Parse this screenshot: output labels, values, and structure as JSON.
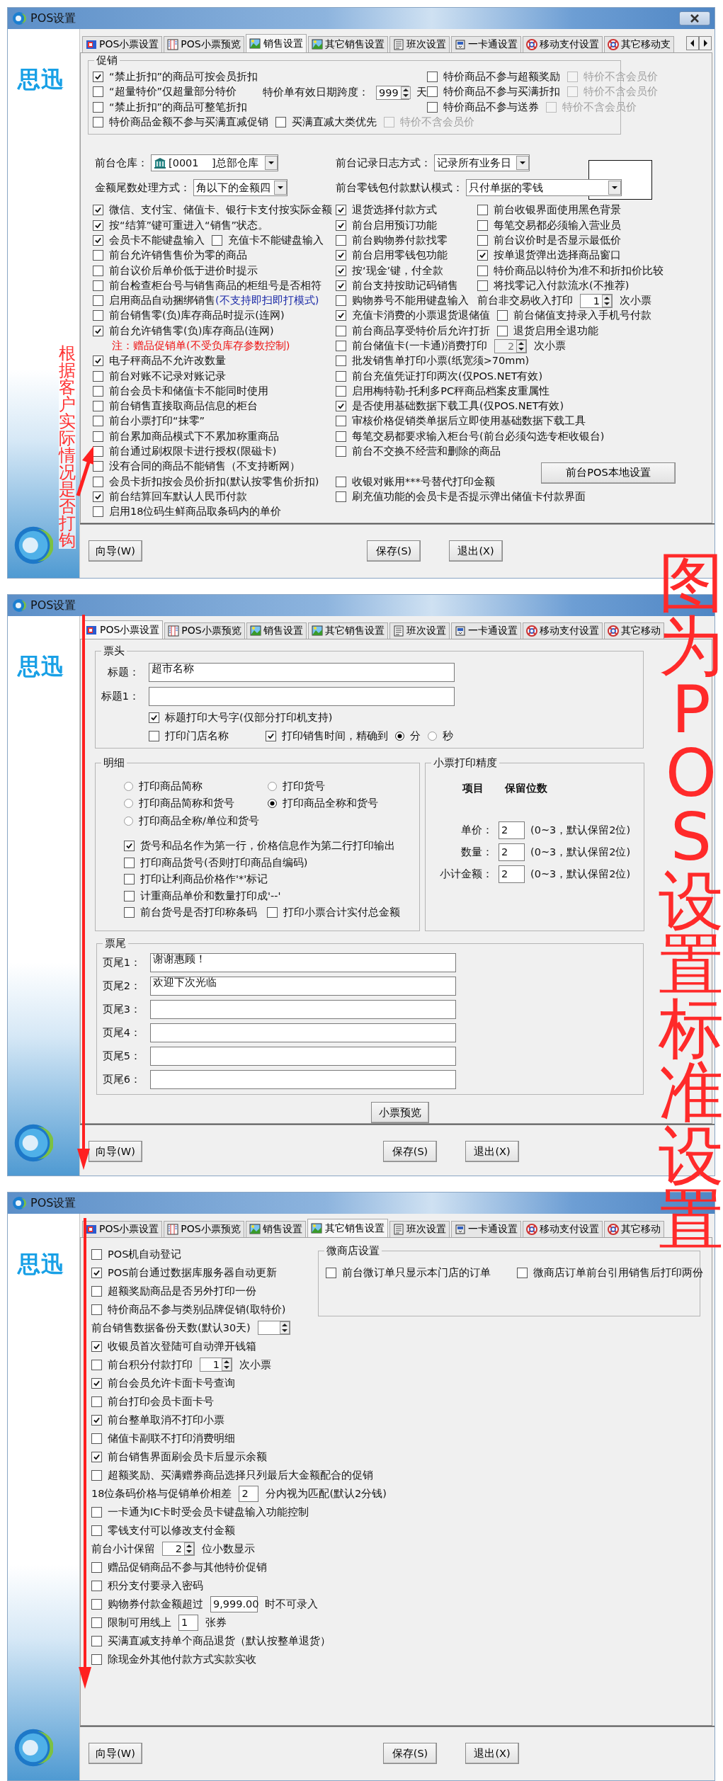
{
  "windows": [
    {
      "title": "POS设置",
      "brand": "思迅",
      "kind": "sales",
      "close_button": true,
      "tab_arrows": true,
      "tabs": [
        {
          "label": "POS小票设置",
          "selected": false
        },
        {
          "label": "POS小票预览",
          "selected": false
        },
        {
          "label": "销售设置",
          "selected": true
        },
        {
          "label": "其它销售设置",
          "selected": false
        },
        {
          "label": "班次设置",
          "selected": false
        },
        {
          "label": "一卡通设置",
          "selected": false
        },
        {
          "label": "移动支付设置",
          "selected": false
        },
        {
          "label": "其它移动支",
          "selected": false
        }
      ],
      "promo": {
        "title": "促销",
        "left": [
          [
            {
              "kind": "check",
              "label": "“禁止折扣”的商品可按会员折扣",
              "checked": true
            }
          ],
          [
            {
              "kind": "check",
              "label": "“超量特价”仅超量部分特价",
              "checked": false
            }
          ],
          [
            {
              "kind": "check",
              "label": "“禁止折扣”的商品可整笔折扣",
              "checked": false
            }
          ],
          [
            {
              "kind": "check",
              "label": "特价商品金额不参与买满直减促销",
              "checked": false
            },
            {
              "kind": "check",
              "label": "买满直减大类优先",
              "checked": false
            },
            {
              "kind": "disabled_check",
              "label": "特价不含会员价",
              "checked": false
            }
          ]
        ],
        "validity": [
          {
            "kind": "text",
            "text": "特价单有效日期跨度："
          },
          {
            "kind": "spin",
            "value": "999"
          },
          {
            "kind": "text",
            "text": "天"
          }
        ],
        "right": [
          [
            {
              "kind": "check",
              "label": "特价商品不参与超额奖励",
              "checked": false
            },
            {
              "kind": "disabled_check",
              "label": "特价不含会员价",
              "checked": false
            }
          ],
          [
            {
              "kind": "check",
              "label": "特价商品不参与买满折扣",
              "checked": false
            },
            {
              "kind": "disabled_check",
              "label": "特价不含会员价",
              "checked": false
            }
          ],
          [
            {
              "kind": "check",
              "label": "特价商品不参与送券",
              "checked": false
            },
            {
              "kind": "disabled_check",
              "label": "特价不含会员价",
              "checked": false
            }
          ]
        ]
      },
      "selects": [
        {
          "kind": "warehouse_combo",
          "label": "前台仓库：",
          "value": "[0001    ]总部仓库"
        },
        {
          "kind": "combo",
          "label": "前台记录日志方式：",
          "value": "记录所有业务日"
        },
        {
          "kind": "combo",
          "label": "金额尾数处理方式：",
          "value": "角以下的金额四"
        },
        {
          "kind": "combo",
          "label": "前台零钱包付款默认模式：",
          "value": "只付单据的零钱"
        }
      ],
      "left": [
        [
          {
            "kind": "check",
            "label": "微信、支付宝、储值卡、银行卡支付按实际金额",
            "checked": true
          }
        ],
        [
          {
            "kind": "check",
            "label": "按“结算”键可重进入“销售”状态。",
            "checked": true
          }
        ],
        [
          {
            "kind": "check",
            "label": "会员卡不能键盘输入",
            "checked": true
          },
          {
            "kind": "check",
            "label": "充值卡不能键盘输入",
            "checked": false
          }
        ],
        [
          {
            "kind": "check",
            "label": "前台允许销售售价为零的商品",
            "checked": false
          }
        ],
        [
          {
            "kind": "check",
            "label": "前台议价后单价低于进价时提示",
            "checked": false
          }
        ],
        [
          {
            "kind": "check",
            "label": "前台检查柜台号与销售商品的柜组号是否相符",
            "checked": false
          }
        ],
        [
          {
            "kind": "check",
            "label": "启用商品自动捆绑销售",
            "hint": "(不支持即扫即打模式)",
            "checked": false
          }
        ],
        [
          {
            "kind": "check",
            "label": "前台销售零(负)库存商品时提示(连网)",
            "checked": false
          }
        ],
        [
          {
            "kind": "check",
            "label": "前台允许销售零(负)库存商品(连网)",
            "checked": true
          }
        ],
        [
          {
            "kind": "note",
            "text": "注：赠品促销单(不受负库存参数控制)"
          }
        ],
        [
          {
            "kind": "check",
            "label": "电子秤商品不允许改数量",
            "checked": true
          }
        ],
        [
          {
            "kind": "check",
            "label": "前台对账不记录对账记录",
            "checked": false
          }
        ],
        [
          {
            "kind": "check",
            "label": "前台会员卡和储值卡不能同时使用",
            "checked": false
          }
        ],
        [
          {
            "kind": "check",
            "label": "前台销售直接取商品信息的柜台",
            "checked": false
          }
        ],
        [
          {
            "kind": "check",
            "label": "前台小票打印“抹零”",
            "checked": false
          }
        ],
        [
          {
            "kind": "check",
            "label": "前台累加商品模式下不累加称重商品",
            "checked": false
          }
        ],
        [
          {
            "kind": "check",
            "label": "前台通过刷权限卡进行授权(限磁卡)",
            "checked": false
          }
        ],
        [
          {
            "kind": "check",
            "label": "没有合同的商品不能销售（不支持断网）",
            "checked": false
          }
        ],
        [
          {
            "kind": "check",
            "label": "会员卡折扣按会员价折扣(默认按零售价折扣)",
            "checked": false
          }
        ],
        [
          {
            "kind": "check",
            "label": "前台结算回车默认人民币付款",
            "checked": true
          }
        ],
        [
          {
            "kind": "check",
            "label": "启用18位码生鲜商品取条码内的单价",
            "checked": false
          }
        ]
      ],
      "right": [
        [
          {
            "kind": "check",
            "label": "退货选择付款方式",
            "checked": true
          },
          {
            "kind": "check",
            "label": "前台收银界面使用黑色背景",
            "checked": false
          }
        ],
        [
          {
            "kind": "check",
            "label": "前台启用预订功能",
            "checked": true
          },
          {
            "kind": "check",
            "label": "每笔交易都必须输入营业员",
            "checked": false
          }
        ],
        [
          {
            "kind": "check",
            "label": "前台购物券付款找零",
            "checked": false
          },
          {
            "kind": "check",
            "label": "前台议价时是否显示最低价",
            "checked": false
          }
        ],
        [
          {
            "kind": "check",
            "label": "前台启用零钱包功能",
            "checked": true
          },
          {
            "kind": "check",
            "label": "按单退货弹出选择商品窗口",
            "checked": true
          }
        ],
        [
          {
            "kind": "check",
            "label": "按‘现金’键，付全款",
            "checked": true
          },
          {
            "kind": "check",
            "label": "特价商品以特价为准不和折扣价比较",
            "checked": false
          }
        ],
        [
          {
            "kind": "check",
            "label": "前台支持按助记码销售",
            "checked": true
          },
          {
            "kind": "check",
            "label": "将找零记入付款流水(不推荐)",
            "checked": false
          }
        ],
        [
          {
            "kind": "check",
            "label": "购物券号不能用键盘输入",
            "checked": false
          },
          {
            "kind": "text",
            "text": "前台非交易收入打印"
          },
          {
            "kind": "spin",
            "value": "1"
          },
          {
            "kind": "text",
            "text": "次小票"
          }
        ],
        [
          {
            "kind": "check",
            "label": "充值卡消费的小票退货退储值",
            "checked": true
          },
          {
            "kind": "check",
            "label": "前台储值支持录入手机号付款",
            "checked": false
          }
        ],
        [
          {
            "kind": "check",
            "label": "前台商品享受特价后允许打折",
            "checked": false
          },
          {
            "kind": "check",
            "label": "退货启用全退功能",
            "checked": false
          }
        ],
        [
          {
            "kind": "check",
            "label": "前台储值卡(一卡通)消费打印",
            "checked": false
          },
          {
            "kind": "disabled_spin",
            "value": "2"
          },
          {
            "kind": "text",
            "text": "次小票"
          }
        ],
        [
          {
            "kind": "check",
            "label": "批发销售单打印小票(纸宽须>70mm)",
            "checked": false
          }
        ],
        [
          {
            "kind": "check",
            "label": "前台充值凭证打印两次(仅POS.NET有效)",
            "checked": false
          }
        ],
        [
          {
            "kind": "check",
            "label": "启用梅特勒-托利多PC秤商品档案皮重属性",
            "checked": false
          }
        ],
        [
          {
            "kind": "check",
            "label": "是否使用基础数据下载工具(仅POS.NET有效)",
            "checked": true
          }
        ],
        [
          {
            "kind": "check",
            "label": "审核价格促销类单据后立即使用基础数据下载工具",
            "checked": false
          }
        ],
        [
          {
            "kind": "check",
            "label": "每笔交易都要求输入柜台号(前台必须勾选专柜收银台)",
            "checked": false
          }
        ],
        [
          {
            "kind": "check",
            "label": "前台不交换不经营和删除的商品",
            "checked": false
          }
        ],
        [
          {
            "kind": "button",
            "label": "前台POS本地设置"
          }
        ],
        [
          {
            "kind": "check",
            "label": "收银对账用***号替代打印金额",
            "checked": false
          }
        ],
        [
          {
            "kind": "check",
            "label": "刷充值功能的会员卡是否提示弹出储值卡付款界面",
            "checked": false
          }
        ]
      ],
      "footer": [
        "向导(W)",
        "保存(S)",
        "退出(X)"
      ]
    },
    {
      "title": "POS设置",
      "brand": "思迅",
      "kind": "receipt",
      "tabs": [
        {
          "label": "POS小票设置",
          "selected": true
        },
        {
          "label": "POS小票预览",
          "selected": false
        },
        {
          "label": "销售设置",
          "selected": false
        },
        {
          "label": "其它销售设置",
          "selected": false
        },
        {
          "label": "班次设置",
          "selected": false
        },
        {
          "label": "一卡通设置",
          "selected": false
        },
        {
          "label": "移动支付设置",
          "selected": false
        },
        {
          "label": "其它移动",
          "selected": false
        }
      ],
      "header": {
        "title": "票头",
        "fields": [
          {
            "label": "标题：",
            "value": "超市名称"
          },
          {
            "label": "标题1："
          }
        ],
        "rows": [
          [
            {
              "kind": "check",
              "label": "标题打印大号字(仅部分打印机支持)",
              "checked": true
            }
          ],
          [
            {
              "kind": "check",
              "label": "打印门店名称",
              "checked": false
            },
            {
              "kind": "check",
              "label": "打印销售时间，精确到",
              "checked": true
            },
            {
              "kind": "radio",
              "label": "分",
              "selected": true
            },
            {
              "kind": "radio",
              "label": "秒",
              "selected": false
            }
          ]
        ]
      },
      "detail": {
        "title": "明细",
        "radios": [
          [
            {
              "kind": "radio",
              "label": "打印商品简称",
              "selected": false
            },
            {
              "kind": "radio",
              "label": "打印货号",
              "selected": false
            }
          ],
          [
            {
              "kind": "radio",
              "label": "打印商品简称和货号",
              "selected": false
            },
            {
              "kind": "radio",
              "label": "打印商品全称和货号",
              "selected": true
            }
          ],
          [
            {
              "kind": "radio",
              "label": "打印商品全称/单位和货号",
              "selected": false
            }
          ]
        ],
        "checks": [
          [
            {
              "kind": "check",
              "label": "货号和品名作为第一行，价格信息作为第二行打印输出",
              "checked": true
            }
          ],
          [
            {
              "kind": "check",
              "label": "打印商品货号(否则打印商品自编码)",
              "checked": false
            }
          ],
          [
            {
              "kind": "check",
              "label": "打印让利商品价格作'*'标记",
              "checked": false
            }
          ],
          [
            {
              "kind": "check",
              "label": "计重商品单价和数量打印成'--'",
              "checked": false
            }
          ],
          [
            {
              "kind": "check",
              "label": "前台货号是否打印称条码",
              "checked": false
            },
            {
              "kind": "check",
              "label": "打印小票合计实付总金额",
              "checked": false
            }
          ]
        ]
      },
      "precision": {
        "title": "小票打印精度",
        "columns": [
          "项目",
          "保留位数"
        ],
        "items": [
          {
            "label": "单价：",
            "value": "2",
            "hint": "(0~3，默认保留2位)"
          },
          {
            "label": "数量：",
            "value": "2",
            "hint": "(0~3，默认保留2位)"
          },
          {
            "label": "小计金额：",
            "value": "2",
            "hint": "(0~3，默认保留2位)"
          }
        ]
      },
      "trailer": {
        "title": "票尾",
        "fields": [
          {
            "label": "页尾1：",
            "value": "谢谢惠顾！"
          },
          {
            "label": "页尾2：",
            "value": "欢迎下次光临"
          },
          {
            "label": "页尾3："
          },
          {
            "label": "页尾4："
          },
          {
            "label": "页尾5："
          },
          {
            "label": "页尾6："
          }
        ]
      },
      "preview_button": "小票预览",
      "footer": [
        "向导(W)",
        "保存(S)",
        "退出(X)"
      ]
    },
    {
      "title": "POS设置",
      "brand": "思迅",
      "kind": "other",
      "tabs": [
        {
          "label": "POS小票设置",
          "selected": false
        },
        {
          "label": "POS小票预览",
          "selected": false
        },
        {
          "label": "销售设置",
          "selected": false
        },
        {
          "label": "其它销售设置",
          "selected": true
        },
        {
          "label": "班次设置",
          "selected": false
        },
        {
          "label": "一卡通设置",
          "selected": false
        },
        {
          "label": "移动支付设置",
          "selected": false
        },
        {
          "label": "其它移动",
          "selected": false
        }
      ],
      "left": [
        [
          {
            "kind": "check",
            "label": "POS机自动登记",
            "checked": false
          }
        ],
        [
          {
            "kind": "check",
            "label": "POS前台通过数据库服务器自动更新",
            "checked": true
          }
        ],
        [
          {
            "kind": "check",
            "label": "超额奖励商品是否另外打印一份",
            "checked": false
          }
        ],
        [
          {
            "kind": "check",
            "label": "特价商品不参与类别品牌促销(取特价)",
            "checked": false
          }
        ],
        [
          {
            "kind": "text",
            "text": "前台销售数据备份天数(默认30天)"
          },
          {
            "kind": "spin"
          }
        ],
        [
          {
            "kind": "check",
            "label": "收银员首次登陆可自动弹开钱箱",
            "checked": true
          }
        ],
        [
          {
            "kind": "check",
            "label": "前台积分付款打印",
            "checked": false
          },
          {
            "kind": "spin",
            "value": "1"
          },
          {
            "kind": "text",
            "text": "次小票"
          }
        ],
        [
          {
            "kind": "check",
            "label": "前台会员允许卡面卡号查询",
            "checked": true
          }
        ],
        [
          {
            "kind": "check",
            "label": "前台打印会员卡面卡号",
            "checked": false
          }
        ],
        [
          {
            "kind": "check",
            "label": "前台整单取消不打印小票",
            "checked": true
          }
        ],
        [
          {
            "kind": "check",
            "label": "储值卡副联不打印消费明细",
            "checked": false
          }
        ],
        [
          {
            "kind": "check",
            "label": "前台销售界面刷会员卡后显示余额",
            "checked": true
          }
        ],
        [
          {
            "kind": "check",
            "label": "超额奖励、买满赠券商品选择只列最后大金额配合的促销",
            "checked": false
          }
        ],
        [
          {
            "kind": "text",
            "text": "18位条码价格与促销单价相差"
          },
          {
            "kind": "field",
            "value": "2"
          },
          {
            "kind": "text",
            "text": "分内视为匹配(默认2分钱)"
          }
        ],
        [
          {
            "kind": "check",
            "label": "一卡通为IC卡时受会员卡键盘输入功能控制",
            "checked": false
          }
        ],
        [
          {
            "kind": "check",
            "label": "零钱支付可以修改支付金额",
            "checked": false
          }
        ],
        [
          {
            "kind": "text",
            "text": "前台小计保留"
          },
          {
            "kind": "spin",
            "value": "2"
          },
          {
            "kind": "text",
            "text": "位小数显示"
          }
        ],
        [
          {
            "kind": "check",
            "label": "赠品促销商品不参与其他特价促销",
            "checked": false
          }
        ],
        [
          {
            "kind": "check",
            "label": "积分支付要录入密码",
            "checked": false
          }
        ],
        [
          {
            "kind": "check",
            "label": "购物券付款金额超过",
            "checked": false
          },
          {
            "kind": "field",
            "value": "9,999.00"
          },
          {
            "kind": "text",
            "text": "时不可录入"
          }
        ],
        [
          {
            "kind": "check",
            "label": "限制可用线上",
            "checked": false
          },
          {
            "kind": "field",
            "value": "1"
          },
          {
            "kind": "text",
            "text": "张券"
          }
        ],
        [
          {
            "kind": "check",
            "label": "买满直减支持单个商品退货（默认按整单退货）",
            "checked": false
          }
        ],
        [
          {
            "kind": "check",
            "label": "除现金外其他付款方式实款实收",
            "checked": false
          }
        ]
      ],
      "wechat": {
        "title": "微商店设置",
        "rows": [
          [
            {
              "kind": "check",
              "label": "前台微订单只显示本门店的订单",
              "checked": false
            },
            {
              "kind": "check",
              "label": "微商店订单前台引用销售后打印两份",
              "checked": false
            }
          ]
        ]
      },
      "footer": [
        "向导(W)",
        "保存(S)",
        "退出(X)"
      ]
    }
  ],
  "annotations": [
    {
      "kind": "side_note",
      "text": "根据客户实际情况是否打钩"
    },
    {
      "kind": "banner",
      "text": "图为POS设置标准设置"
    }
  ]
}
